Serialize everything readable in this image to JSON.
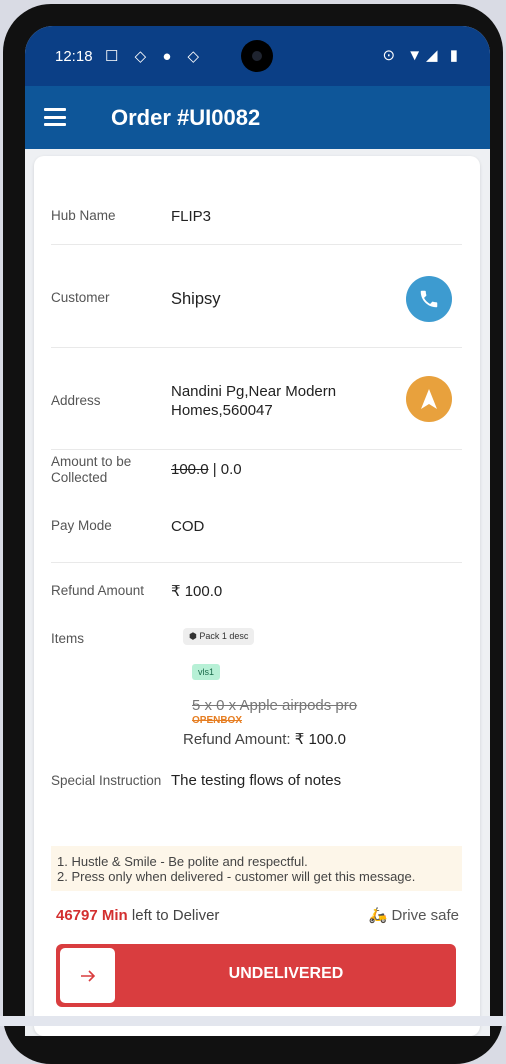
{
  "status_bar": {
    "time": "12:18"
  },
  "app_bar": {
    "title": "Order #UI0082"
  },
  "details": {
    "hub_name_label": "Hub Name",
    "hub_name": "FLIP3",
    "customer_label": "Customer",
    "customer": "Shipsy",
    "address_label": "Address",
    "address_line1": "Nandini Pg,Near Modern",
    "address_line2": "Homes,560047",
    "amount_label_line1": "Amount to be",
    "amount_label_line2": "Collected",
    "amount_original": "100.0",
    "amount_separator": " | ",
    "amount_current": "0.0",
    "pay_mode_label": "Pay Mode",
    "pay_mode": "COD",
    "refund_label": "Refund Amount",
    "refund_amount": "₹ 100.0",
    "items_label": "Items",
    "pack_chip": "Pack 1 desc",
    "item_tag": "vls1",
    "item_line": "5 x 0 x Apple airpods pro",
    "item_condition": "OPENBOX",
    "item_refund_label": "Refund Amount:",
    "item_refund_value": "₹ 100.0",
    "special_label": "Special Instruction",
    "special_value": "The testing flows of notes"
  },
  "instructions": [
    "1. Hustle & Smile - Be polite and respectful.",
    "2. Press only when delivered - customer will get this message."
  ],
  "timer": {
    "minutes": "46797 Min",
    "suffix": "left to Deliver"
  },
  "drive_safe": "Drive safe",
  "cta": {
    "label": "UNDELIVERED"
  },
  "colors": {
    "status_bar": "#0b3f86",
    "app_bar": "#0e5699",
    "call_button": "#3d9bd0",
    "navigate_button": "#e8a13d",
    "cta": "#d93d3f",
    "timer": "#d32f2f"
  },
  "icons": {
    "menu": "menu-icon",
    "call": "phone-icon",
    "navigate": "navigation-icon",
    "box": "box-icon",
    "rider": "scooter-icon",
    "arrow": "arrow-right-icon"
  }
}
